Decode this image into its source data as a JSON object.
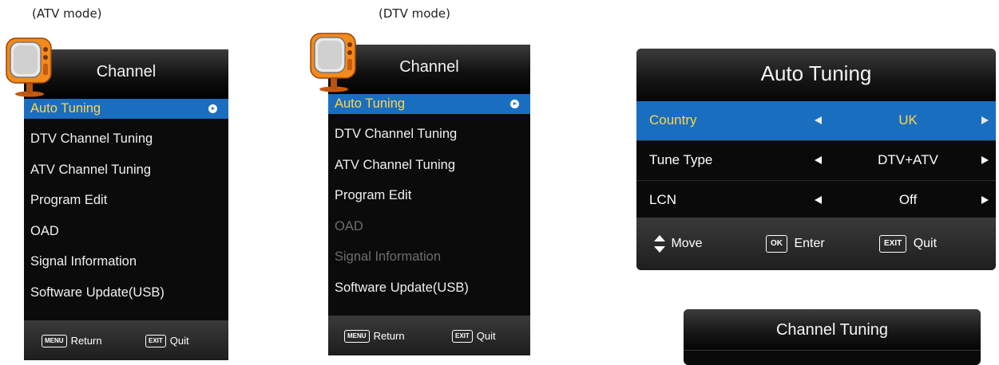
{
  "captions": {
    "atv": "(ATV mode)",
    "dtv": "(DTV mode)"
  },
  "atv_menu": {
    "title": "Channel",
    "items": [
      {
        "label": "Auto Tuning",
        "state": "selected"
      },
      {
        "label": "DTV Channel Tuning",
        "state": "normal"
      },
      {
        "label": "ATV Channel Tuning",
        "state": "normal"
      },
      {
        "label": "Program Edit",
        "state": "normal"
      },
      {
        "label": "OAD",
        "state": "normal"
      },
      {
        "label": "Signal Information",
        "state": "normal"
      },
      {
        "label": "Software Update(USB)",
        "state": "normal"
      }
    ],
    "footer": {
      "menu_key": "MENU",
      "return_label": "Return",
      "exit_key": "EXIT",
      "quit_label": "Quit"
    }
  },
  "dtv_menu": {
    "title": "Channel",
    "items": [
      {
        "label": "Auto Tuning",
        "state": "selected"
      },
      {
        "label": "DTV Channel Tuning",
        "state": "normal"
      },
      {
        "label": "ATV Channel Tuning",
        "state": "normal"
      },
      {
        "label": "Program Edit",
        "state": "normal"
      },
      {
        "label": "OAD",
        "state": "disabled"
      },
      {
        "label": "Signal Information",
        "state": "disabled"
      },
      {
        "label": "Software Update(USB)",
        "state": "normal"
      }
    ],
    "footer": {
      "menu_key": "MENU",
      "return_label": "Return",
      "exit_key": "EXIT",
      "quit_label": "Quit"
    }
  },
  "auto_tuning": {
    "title": "Auto Tuning",
    "rows": [
      {
        "label": "Country",
        "value": "UK",
        "selected": true
      },
      {
        "label": "Tune Type",
        "value": "DTV+ATV",
        "selected": false
      },
      {
        "label": "LCN",
        "value": "Off",
        "selected": false
      }
    ],
    "footer": {
      "move_label": "Move",
      "ok_key": "OK",
      "enter_label": "Enter",
      "exit_key": "EXIT",
      "quit_label": "Quit"
    }
  },
  "channel_tuning": {
    "title": "Channel Tuning"
  },
  "colors": {
    "highlight": "#1a6ec0",
    "selected_text": "#ffd54a",
    "disabled_text": "#6d6d6d"
  }
}
